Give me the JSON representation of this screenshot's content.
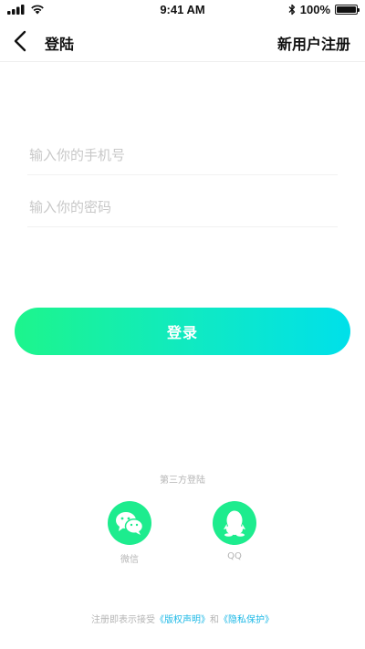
{
  "status_bar": {
    "time": "9:41 AM",
    "battery_text": "100%",
    "battery_level": 1.0
  },
  "nav": {
    "back_icon": "chevron-left-icon",
    "title": "登陆",
    "register_label": "新用户注册"
  },
  "form": {
    "phone_placeholder": "输入你的手机号",
    "password_placeholder": "输入你的密码",
    "phone_value": "",
    "password_value": ""
  },
  "login_button": {
    "label": "登录"
  },
  "third_party": {
    "title": "第三方登陆",
    "wechat_label": "微信",
    "qq_label": "QQ"
  },
  "agreement": {
    "prefix": "注册即表示接受",
    "copyright_link": "《版权声明》",
    "joiner": "和",
    "privacy_link": "《隐私保护》"
  },
  "colors": {
    "accent_start": "#1df58c",
    "accent_end": "#00e0ea",
    "link": "#1bb8e6",
    "placeholder": "#c8c8c8"
  }
}
